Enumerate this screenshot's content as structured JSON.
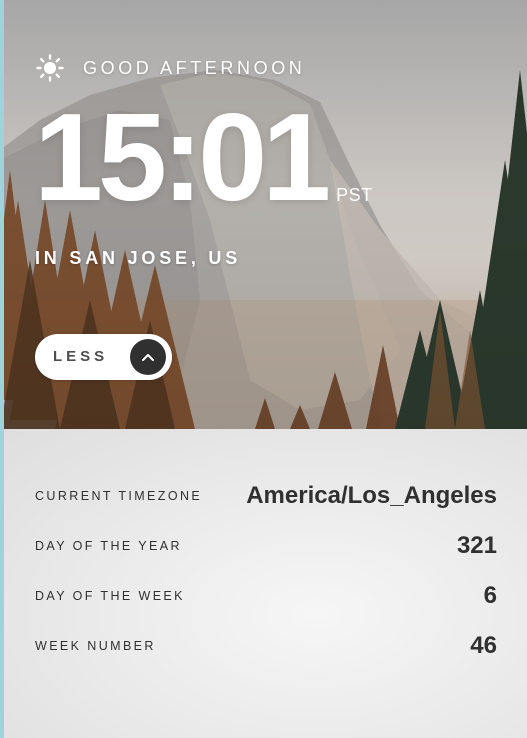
{
  "greeting": {
    "icon": "sun-icon",
    "text": "GOOD AFTERNOON"
  },
  "clock": {
    "time": "15:01",
    "timezone_abbr": "PST",
    "location": "IN SAN JOSE, US"
  },
  "toggle": {
    "label": "LESS",
    "icon": "chevron-up-icon"
  },
  "details": {
    "timezone": {
      "label": "CURRENT TIMEZONE",
      "value": "America/Los_Angeles"
    },
    "day_of_year": {
      "label": "DAY OF THE YEAR",
      "value": "321"
    },
    "day_of_week": {
      "label": "DAY OF THE WEEK",
      "value": "6"
    },
    "week_number": {
      "label": "WEEK NUMBER",
      "value": "46"
    }
  },
  "colors": {
    "text_light": "#ffffff",
    "text_dark": "#303030",
    "button_bg": "#ffffff",
    "button_icon_bg": "#303030",
    "panel_bg": "#e9e9e9",
    "left_edge": "#9fd3db"
  }
}
